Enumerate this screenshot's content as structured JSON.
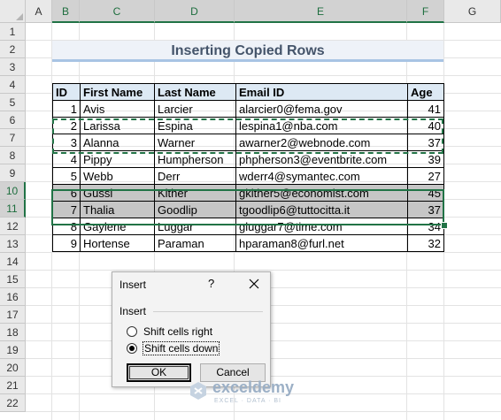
{
  "sheet": {
    "columns": [
      "A",
      "B",
      "C",
      "D",
      "E",
      "F",
      "G"
    ],
    "selected_columns": [
      "B",
      "C",
      "D",
      "E",
      "F"
    ],
    "rows": [
      1,
      2,
      3,
      4,
      5,
      6,
      7,
      8,
      9,
      10,
      11,
      12,
      13,
      14,
      15,
      16,
      17,
      18,
      19,
      20,
      21,
      22
    ],
    "selected_rows": [
      10,
      11
    ]
  },
  "title": "Inserting Copied Rows",
  "table": {
    "headers": [
      "ID",
      "First Name",
      "Last Name",
      "Email ID",
      "Age"
    ],
    "rows": [
      {
        "id": "1",
        "first": "Avis",
        "last": "Larcier",
        "email": "alarcier0@fema.gov",
        "age": "41",
        "selected": false
      },
      {
        "id": "2",
        "first": "Larissa",
        "last": "Espina",
        "email": "lespina1@nba.com",
        "age": "40",
        "selected": false
      },
      {
        "id": "3",
        "first": "Alanna",
        "last": "Warner",
        "email": "awarner2@webnode.com",
        "age": "37",
        "selected": false
      },
      {
        "id": "4",
        "first": "Pippy",
        "last": "Humpherson",
        "email": "phpherson3@eventbrite.com",
        "age": "39",
        "selected": false
      },
      {
        "id": "5",
        "first": "Webb",
        "last": "Derr",
        "email": "wderr4@symantec.com",
        "age": "27",
        "selected": false
      },
      {
        "id": "6",
        "first": "Gussi",
        "last": "Kither",
        "email": "gkither5@economist.com",
        "age": "45",
        "selected": true
      },
      {
        "id": "7",
        "first": "Thalia",
        "last": "Goodlip",
        "email": "tgoodlip6@tuttocitta.it",
        "age": "37",
        "selected": true
      },
      {
        "id": "8",
        "first": "Gaylene",
        "last": "Luggar",
        "email": "gluggar7@time.com",
        "age": "34",
        "selected": false
      },
      {
        "id": "9",
        "first": "Hortense",
        "last": "Paraman",
        "email": "hparaman8@furl.net",
        "age": "32",
        "selected": false
      }
    ]
  },
  "dialog": {
    "title": "Insert",
    "help": "?",
    "close_icon": "close-icon",
    "group_label": "Insert",
    "option_right": "Shift cells right",
    "option_down": "Shift cells down",
    "selected_option": "down",
    "ok_label": "OK",
    "cancel_label": "Cancel"
  },
  "watermark": {
    "name": "exceldemy",
    "tagline": "EXCEL · DATA · BI"
  },
  "colors": {
    "selection_green": "#217346",
    "header_fill": "#dde9f4",
    "title_text": "#44546a"
  }
}
